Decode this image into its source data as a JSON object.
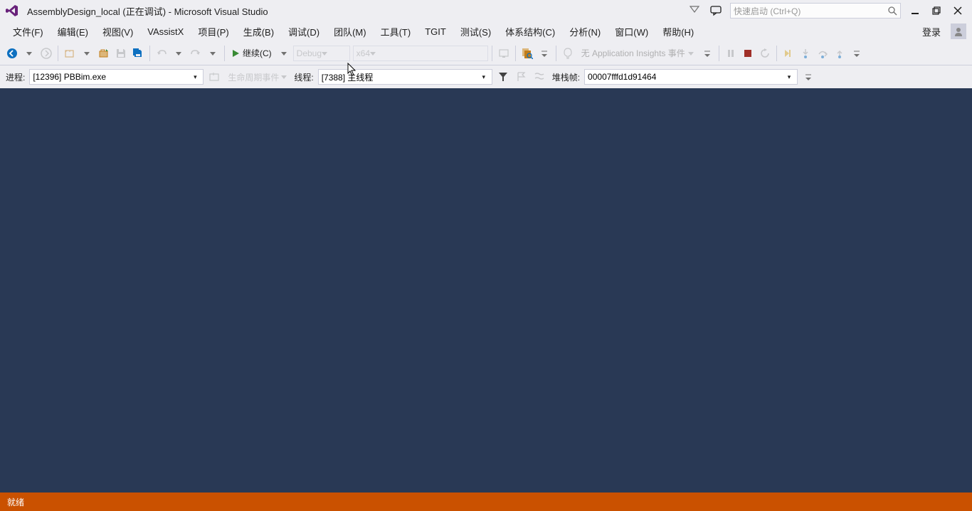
{
  "titlebar": {
    "title": "AssemblyDesign_local (正在调试) - Microsoft Visual Studio"
  },
  "quick_launch": {
    "placeholder": "快速启动 (Ctrl+Q)"
  },
  "menubar": {
    "items": [
      "文件(F)",
      "编辑(E)",
      "视图(V)",
      "VAssistX",
      "项目(P)",
      "生成(B)",
      "调试(D)",
      "团队(M)",
      "工具(T)",
      "TGIT",
      "测试(S)",
      "体系结构(C)",
      "分析(N)",
      "窗口(W)",
      "帮助(H)"
    ],
    "login": "登录"
  },
  "toolbar": {
    "continue_label": "继续(C)",
    "config": "Debug",
    "platform": "x64",
    "app_insights": "无 Application Insights 事件"
  },
  "debugbar": {
    "process_label": "进程:",
    "process_value": "[12396] PBBim.exe",
    "lifecycle_label": "生命周期事件",
    "thread_label": "线程:",
    "thread_value": "[7388] 主线程",
    "stackframe_label": "堆栈帧:",
    "stackframe_value": "00007fffd1d91464"
  },
  "statusbar": {
    "text": "就绪"
  }
}
